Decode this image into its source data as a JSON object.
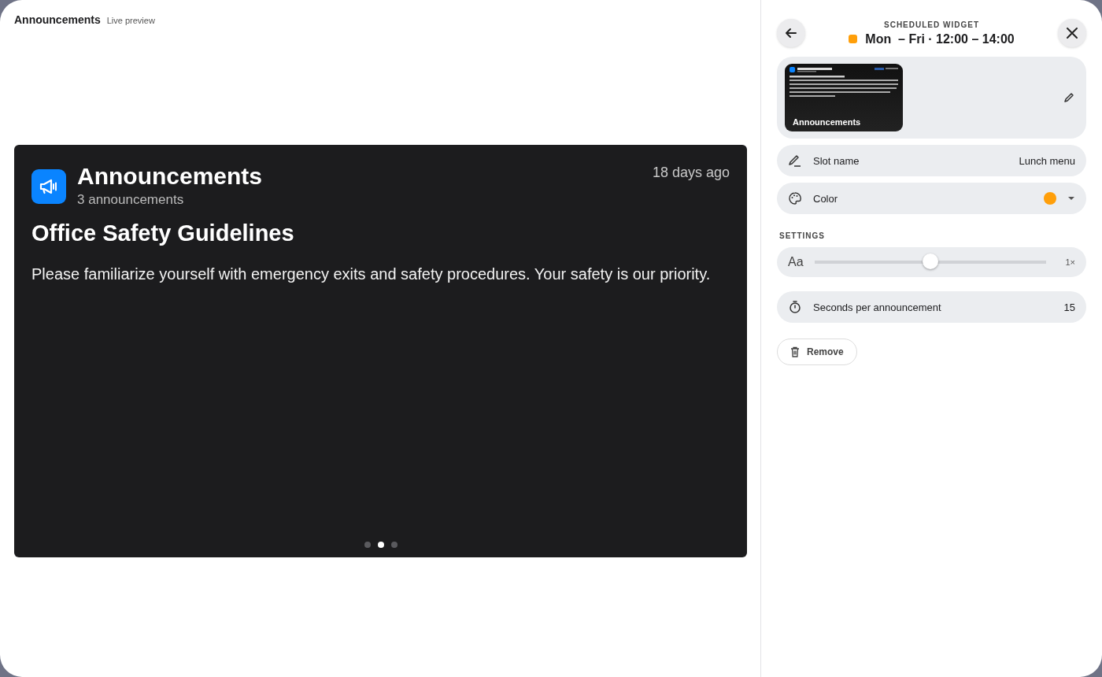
{
  "header": {
    "title": "Announcements",
    "subtitle": "Live preview"
  },
  "card": {
    "title": "Announcements",
    "count": "3 announcements",
    "time": "18 days ago",
    "headline": "Office Safety Guidelines",
    "body": "Please familiarize yourself with emergency exits and safety procedures. Your safety is our priority.",
    "dots": [
      {
        "selected": false
      },
      {
        "selected": true
      },
      {
        "selected": false
      }
    ]
  },
  "panel": {
    "eyebrow": "SCHEDULED WIDGET",
    "schedule": {
      "text": "Mon  – Fri · 12:00 – 14:00",
      "color": "#ff9f0a"
    },
    "thumbnail": {
      "label": "Announcements"
    },
    "slot_name": {
      "label": "Slot name",
      "value": "Lunch menu"
    },
    "color": {
      "label": "Color",
      "color": "#ff9f0a"
    },
    "settings_label": "SETTINGS",
    "text_size": {
      "label": "Aa",
      "level": 0.5,
      "reading": "1×"
    },
    "seconds": {
      "label": "Seconds per announcement",
      "value": "15"
    },
    "remove": "Remove"
  }
}
